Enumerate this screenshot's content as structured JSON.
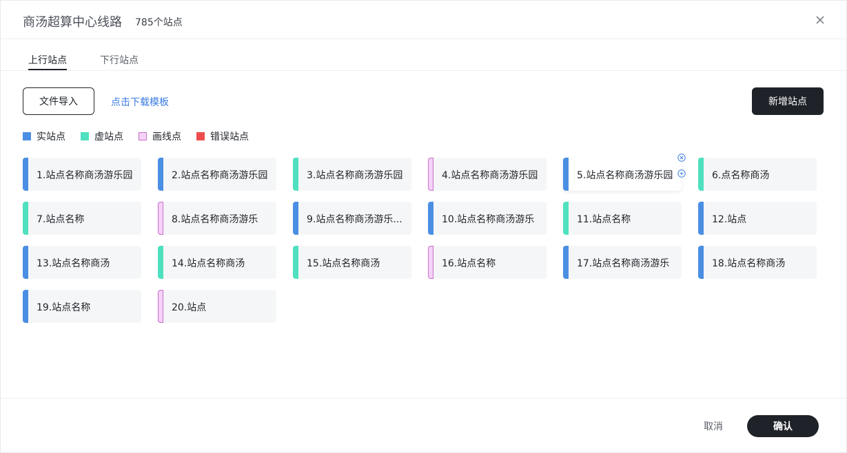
{
  "header": {
    "title": "商汤超算中心线路",
    "station_count": "785个站点",
    "close_icon": "close-icon"
  },
  "tabs": [
    {
      "label": "上行站点",
      "active": true
    },
    {
      "label": "下行站点",
      "active": false
    }
  ],
  "toolbar": {
    "import_label": "文件导入",
    "template_link": "点击下载模板",
    "add_label": "新增站点"
  },
  "legend": [
    {
      "label": "实站点",
      "type": "real",
      "color": "#4a8fe3"
    },
    {
      "label": "虚站点",
      "type": "virtual",
      "color": "#4fe0bf"
    },
    {
      "label": "画线点",
      "type": "draw",
      "color": "#f5d2f7",
      "border": "#c76fcc"
    },
    {
      "label": "错误站点",
      "type": "error",
      "color": "#ee4d4d"
    }
  ],
  "stations": [
    {
      "label": "1.站点名称商汤游乐园",
      "type": "real"
    },
    {
      "label": "2.站点名称商汤游乐园",
      "type": "real"
    },
    {
      "label": "3.站点名称商汤游乐园",
      "type": "virtual"
    },
    {
      "label": "4.站点名称商汤游乐园",
      "type": "draw"
    },
    {
      "label": "5.站点名称商汤游乐园",
      "type": "real",
      "hover": true
    },
    {
      "label": "6.点名称商汤",
      "type": "virtual"
    },
    {
      "label": "7.站点名称",
      "type": "virtual"
    },
    {
      "label": "8.站点名称商汤游乐",
      "type": "draw"
    },
    {
      "label": "9.站点名称商汤游乐...",
      "type": "real"
    },
    {
      "label": "10.站点名称商汤游乐",
      "type": "real"
    },
    {
      "label": "11.站点名称",
      "type": "virtual"
    },
    {
      "label": "12.站点",
      "type": "real"
    },
    {
      "label": "13.站点名称商汤",
      "type": "real"
    },
    {
      "label": "14.站点名称商汤",
      "type": "virtual"
    },
    {
      "label": "15.站点名称商汤",
      "type": "virtual"
    },
    {
      "label": "16.站点名称",
      "type": "draw"
    },
    {
      "label": "17.站点名称商汤游乐",
      "type": "real"
    },
    {
      "label": "18.站点名称商汤",
      "type": "real"
    },
    {
      "label": "19.站点名称",
      "type": "real"
    },
    {
      "label": "20.站点",
      "type": "draw"
    }
  ],
  "footer": {
    "cancel_label": "取消",
    "confirm_label": "确认"
  }
}
